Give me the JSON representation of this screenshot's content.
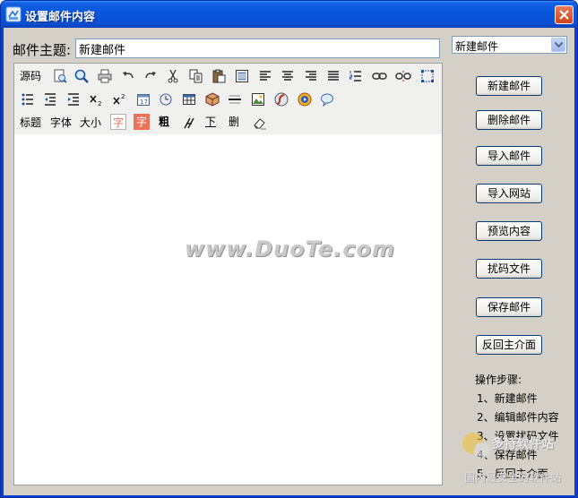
{
  "window": {
    "title": "设置邮件内容"
  },
  "subject": {
    "label": "邮件主题:",
    "value": "新建邮件"
  },
  "mail_select": {
    "selected": "新建邮件"
  },
  "toolbar": {
    "row1": [
      "source-code",
      "preview-page",
      "search-zoom",
      "print",
      "undo",
      "redo",
      "cut",
      "copy",
      "paste",
      "select-all",
      "align-left",
      "align-center",
      "align-right",
      "align-justify",
      "ordered-list",
      "link",
      "unlink",
      "anchor"
    ],
    "source_label": "源码",
    "row3_labels": {
      "heading": "标题",
      "font": "字体",
      "size": "大小",
      "font_color": "字",
      "bg_color": "字",
      "bold": "粗",
      "underline": "下",
      "strike": "删"
    }
  },
  "watermark": "www.DuoTe.com",
  "buttons": {
    "new_mail": "新建邮件",
    "delete_mail": "删除邮件",
    "import_mail": "导入邮件",
    "import_site": "导入网站",
    "preview": "预览内容",
    "scramble": "扰码文件",
    "save": "保存邮件",
    "back": "反回主介面"
  },
  "steps": {
    "title": "操作步骤:",
    "items": [
      "1、新建邮件",
      "2、编辑邮件内容",
      "3、设置扰码文件",
      "4、保存邮件",
      "5、反回主介面"
    ]
  },
  "logo": {
    "top": "多特软件站",
    "bottom": "国内最安全的软件站"
  },
  "colors": {
    "titlebar": "#0855dc",
    "client": "#d4d0c8",
    "close": "#d0421c",
    "accent_red": "#e8735a"
  }
}
